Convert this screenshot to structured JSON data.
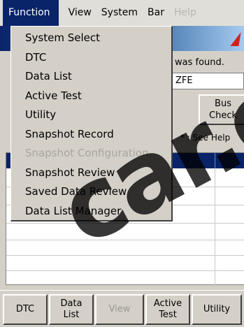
{
  "menubar": {
    "items": [
      {
        "label": "Function",
        "state": "active"
      },
      {
        "label": "View",
        "state": "normal"
      },
      {
        "label": "System",
        "state": "normal"
      },
      {
        "label": "Bar",
        "state": "normal"
      },
      {
        "label": "Help",
        "state": "disabled"
      }
    ]
  },
  "function_menu": {
    "items": [
      {
        "label": "System Select",
        "enabled": true
      },
      {
        "label": "DTC",
        "enabled": true
      },
      {
        "label": "Data List",
        "enabled": true
      },
      {
        "label": "Active Test",
        "enabled": true
      },
      {
        "label": "Utility",
        "enabled": true
      },
      {
        "label": "Snapshot Record",
        "enabled": true
      },
      {
        "label": "Snapshot Configuration",
        "enabled": false
      },
      {
        "label": "Snapshot Review",
        "enabled": true
      },
      {
        "label": "Saved Data Review",
        "enabled": true
      },
      {
        "label": "Data List Manager",
        "enabled": true
      }
    ]
  },
  "main": {
    "status_text": "was found.",
    "vehicle_value": "ZFE",
    "bus_check_label": "Bus\nCheck",
    "help_note": "* : See Help"
  },
  "bottombar": {
    "buttons": [
      {
        "label": "DTC",
        "enabled": true
      },
      {
        "label": "Data\nList",
        "enabled": true
      },
      {
        "label": "View",
        "enabled": false
      },
      {
        "label": "Active\nTest",
        "enabled": true
      },
      {
        "label": "Utility",
        "enabled": true
      }
    ]
  },
  "watermark_text": "car.c",
  "colors": {
    "accent": "#0a246a",
    "panel": "#d4d0c8",
    "warning_mark": "#d02020"
  }
}
